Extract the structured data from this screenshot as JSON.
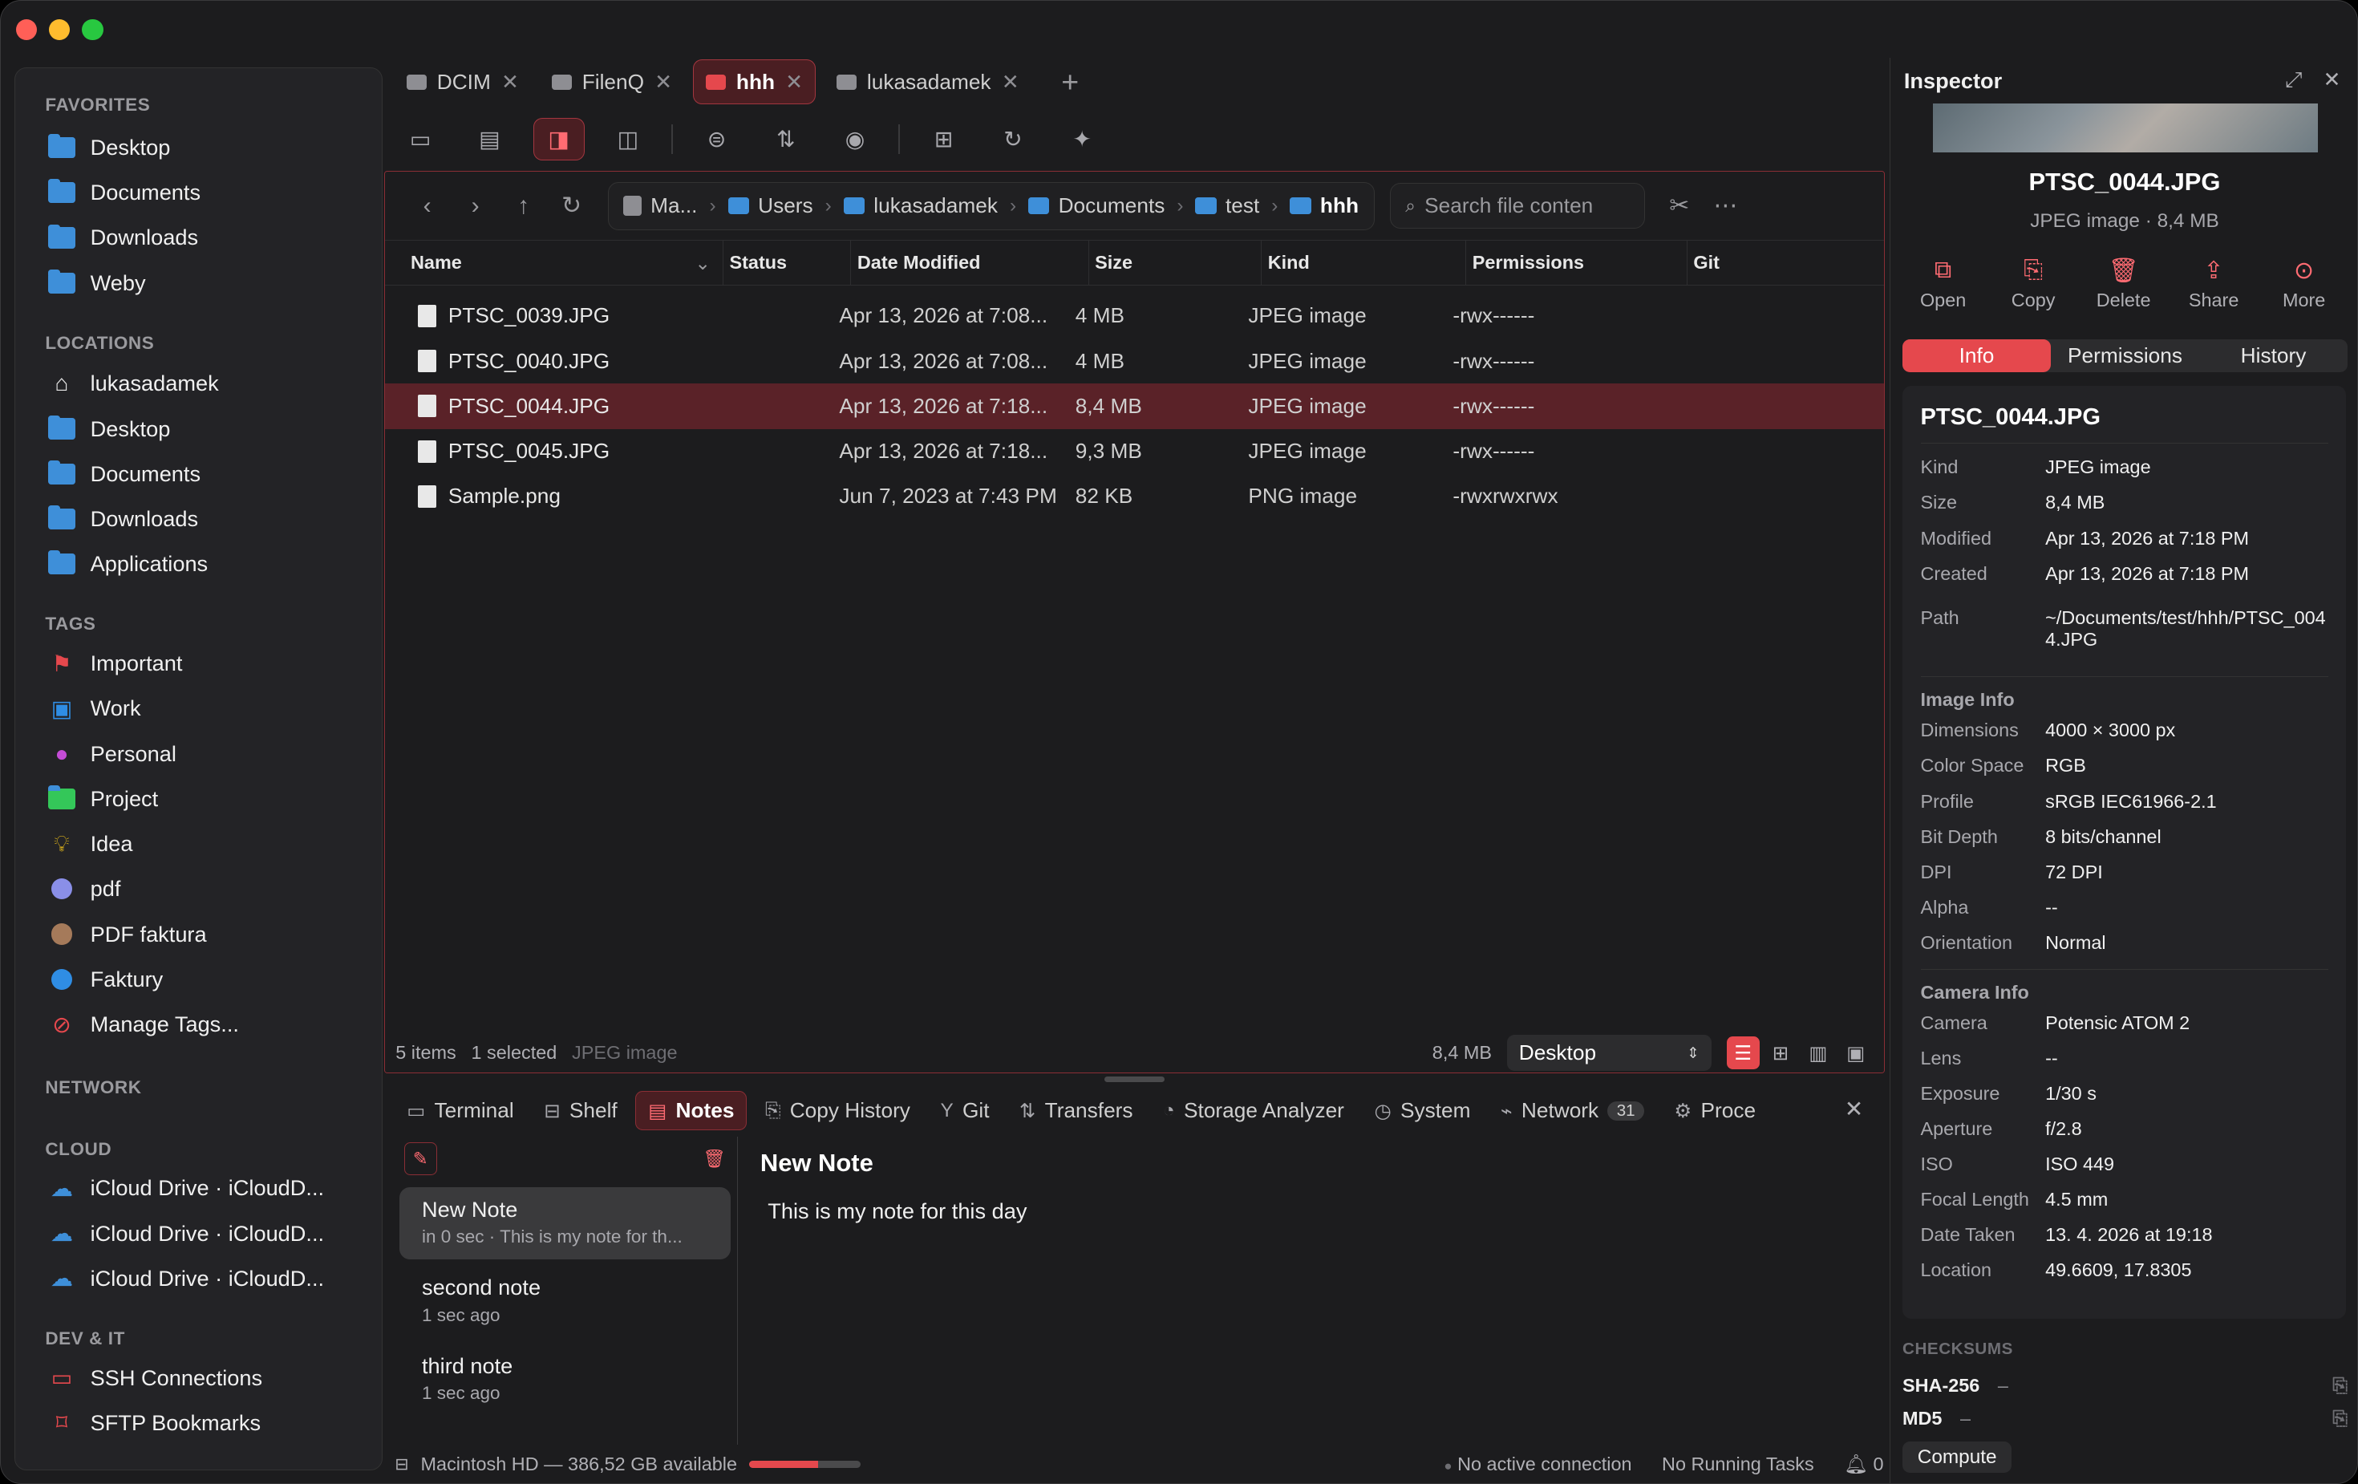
{
  "window": {
    "traffic_colors": [
      "#ff5f57",
      "#febc2e",
      "#28c840"
    ]
  },
  "sidebar": {
    "favorites_title": "FAVORITES",
    "favorites": [
      "Desktop",
      "Documents",
      "Downloads",
      "Weby"
    ],
    "locations_title": "LOCATIONS",
    "locations": [
      {
        "label": "lukasadamek",
        "icon": "home-icon"
      },
      {
        "label": "Desktop",
        "icon": "folder-icon"
      },
      {
        "label": "Documents",
        "icon": "folder-icon"
      },
      {
        "label": "Downloads",
        "icon": "folder-icon"
      },
      {
        "label": "Applications",
        "icon": "folder-icon"
      }
    ],
    "tags_title": "TAGS",
    "tags": [
      {
        "label": "Important",
        "color": "#e5484d",
        "icon": "flag-icon"
      },
      {
        "label": "Work",
        "color": "#2f8de4",
        "icon": "briefcase-icon"
      },
      {
        "label": "Personal",
        "color": "#c44cd6",
        "icon": "person-icon"
      },
      {
        "label": "Project",
        "color": "#34c759",
        "icon": "folder-icon"
      },
      {
        "label": "Idea",
        "color": "#f5c518",
        "icon": "lightbulb-icon"
      },
      {
        "label": "pdf",
        "color": "#8a8fe8",
        "icon": "circle-icon"
      },
      {
        "label": "PDF faktura",
        "color": "#a57a5a",
        "icon": "circle-icon"
      },
      {
        "label": "Faktury",
        "color": "#2f8de4",
        "icon": "circle-icon"
      },
      {
        "label": "Manage Tags...",
        "color": "#e5484d",
        "icon": "tag-settings-icon"
      }
    ],
    "network_title": "NETWORK",
    "cloud_title": "CLOUD",
    "cloud": [
      "iCloud Drive · iCloudD...",
      "iCloud Drive · iCloudD...",
      "iCloud Drive · iCloudD..."
    ],
    "devit_title": "DEV & IT",
    "devit": [
      {
        "label": "SSH Connections",
        "icon": "terminal-icon"
      },
      {
        "label": "SFTP Bookmarks",
        "icon": "bookmark-icon"
      }
    ]
  },
  "tabs": [
    {
      "label": "DCIM",
      "active": false
    },
    {
      "label": "FilenQ",
      "active": false
    },
    {
      "label": "hhh",
      "active": true
    },
    {
      "label": "lukasadamek",
      "active": false
    }
  ],
  "toolbar": {
    "buttons": [
      "sidebar-toggle-icon",
      "shelf-icon",
      "inspector-toggle-icon",
      "split-view-icon",
      "filter-icon",
      "sort-icon",
      "preview-eye-icon",
      "new-folder-icon",
      "refresh-icon",
      "ai-sparkle-icon"
    ]
  },
  "path": {
    "crumbs": [
      "Ma...",
      "Users",
      "lukasadamek",
      "Documents",
      "test",
      "hhh"
    ],
    "search_placeholder": "Search file conten"
  },
  "table": {
    "headers": [
      "Name",
      "Status",
      "Date Modified",
      "Size",
      "Kind",
      "Permissions",
      "Git"
    ],
    "rows": [
      {
        "name": "PTSC_0039.JPG",
        "date": "Apr 13, 2026 at 7:08...",
        "size": "4 MB",
        "kind": "JPEG image",
        "perm": "-rwx------",
        "selected": false
      },
      {
        "name": "PTSC_0040.JPG",
        "date": "Apr 13, 2026 at 7:08...",
        "size": "4 MB",
        "kind": "JPEG image",
        "perm": "-rwx------",
        "selected": false
      },
      {
        "name": "PTSC_0044.JPG",
        "date": "Apr 13, 2026 at 7:18...",
        "size": "8,4 MB",
        "kind": "JPEG image",
        "perm": "-rwx------",
        "selected": true
      },
      {
        "name": "PTSC_0045.JPG",
        "date": "Apr 13, 2026 at 7:18...",
        "size": "9,3 MB",
        "kind": "JPEG image",
        "perm": "-rwx------",
        "selected": false
      },
      {
        "name": "Sample.png",
        "date": "Jun 7, 2023 at 7:43 PM",
        "size": "82 KB",
        "kind": "PNG image",
        "perm": "-rwxrwxrwx",
        "selected": false
      }
    ]
  },
  "status": {
    "items": "5 items",
    "selected": "1 selected",
    "kind": "JPEG image",
    "size": "8,4 MB",
    "location": "Desktop"
  },
  "bottom_tabs": [
    {
      "label": "Terminal",
      "icon": "terminal-icon"
    },
    {
      "label": "Shelf",
      "icon": "shelf-icon"
    },
    {
      "label": "Notes",
      "icon": "notes-icon",
      "active": true
    },
    {
      "label": "Copy History",
      "icon": "copy-icon"
    },
    {
      "label": "Git",
      "icon": "git-branch-icon"
    },
    {
      "label": "Transfers",
      "icon": "transfer-icon"
    },
    {
      "label": "Storage Analyzer",
      "icon": "storage-icon"
    },
    {
      "label": "System",
      "icon": "gauge-icon"
    },
    {
      "label": "Network",
      "icon": "network-chart-icon",
      "badge": "31"
    },
    {
      "label": "Proce",
      "icon": "process-icon"
    }
  ],
  "notes": [
    {
      "title": "New Note",
      "sub": "in 0 sec · This is my note for th...",
      "active": true
    },
    {
      "title": "second note",
      "sub": "1 sec ago",
      "active": false
    },
    {
      "title": "third note",
      "sub": "1 sec ago",
      "active": false
    }
  ],
  "editor": {
    "title": "New Note",
    "body": "This is my note for this day"
  },
  "footer": {
    "disk": "Macintosh HD — 386,52 GB available",
    "disk_used_fraction": 0.62,
    "connection": "No active connection",
    "tasks": "No Running Tasks",
    "notifications": "0"
  },
  "inspector": {
    "title": "Inspector",
    "file_name": "PTSC_0044.JPG",
    "file_sub": "JPEG image · 8,4 MB",
    "actions": [
      {
        "label": "Open",
        "icon": "open-icon"
      },
      {
        "label": "Copy",
        "icon": "copy-icon"
      },
      {
        "label": "Delete",
        "icon": "trash-icon"
      },
      {
        "label": "Share",
        "icon": "share-icon"
      },
      {
        "label": "More",
        "icon": "more-icon"
      }
    ],
    "segments": [
      "Info",
      "Permissions",
      "History"
    ],
    "card_title": "PTSC_0044.JPG",
    "general": [
      {
        "k": "Kind",
        "v": "JPEG image"
      },
      {
        "k": "Size",
        "v": "8,4 MB"
      },
      {
        "k": "Modified",
        "v": "Apr 13, 2026 at 7:18 PM"
      },
      {
        "k": "Created",
        "v": "Apr 13, 2026 at 7:18 PM"
      }
    ],
    "path_label": "Path",
    "path_value": "~/Documents/test/hhh/PTSC_0044.JPG",
    "image_info_title": "Image Info",
    "image_info": [
      {
        "k": "Dimensions",
        "v": "4000 × 3000 px"
      },
      {
        "k": "Color Space",
        "v": "RGB"
      },
      {
        "k": "Profile",
        "v": "sRGB IEC61966-2.1"
      },
      {
        "k": "Bit Depth",
        "v": "8 bits/channel"
      },
      {
        "k": "DPI",
        "v": "72 DPI"
      },
      {
        "k": "Alpha",
        "v": "--"
      },
      {
        "k": "Orientation",
        "v": "Normal"
      }
    ],
    "camera_info_title": "Camera Info",
    "camera_info": [
      {
        "k": "Camera",
        "v": "Potensic ATOM 2"
      },
      {
        "k": "Lens",
        "v": "--"
      },
      {
        "k": "Exposure",
        "v": "1/30 s"
      },
      {
        "k": "Aperture",
        "v": "f/2.8"
      },
      {
        "k": "ISO",
        "v": "ISO 449"
      },
      {
        "k": "Focal Length",
        "v": "4.5 mm"
      },
      {
        "k": "Date Taken",
        "v": "13. 4. 2026 at 19:18"
      },
      {
        "k": "Location",
        "v": "49.6609, 17.8305"
      }
    ],
    "checksums_title": "CHECKSUMS",
    "checksums": [
      {
        "k": "SHA-256",
        "v": "–"
      },
      {
        "k": "MD5",
        "v": "–"
      }
    ],
    "compute_label": "Compute"
  }
}
